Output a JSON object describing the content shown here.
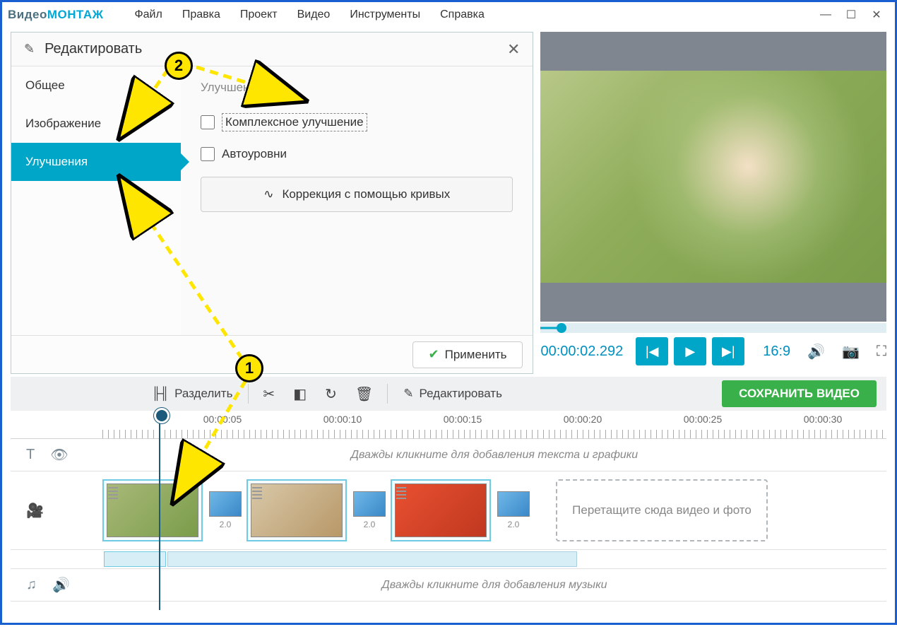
{
  "app": {
    "logo_a": "Видео",
    "logo_b": "МОНТАЖ"
  },
  "menu": [
    "Файл",
    "Правка",
    "Проект",
    "Видео",
    "Инструменты",
    "Справка"
  ],
  "edit_panel": {
    "title": "Редактировать",
    "tabs": [
      "Общее",
      "Изображение",
      "Улучшения"
    ],
    "active_tab": 2,
    "section": "Улучшения",
    "chk_complex": "Комплексное улучшение",
    "chk_auto": "Автоуровни",
    "curves_btn": "Коррекция с помощью кривых",
    "apply": "Применить"
  },
  "preview": {
    "timecode": "00:00:02.292",
    "ratio": "16:9"
  },
  "toolbar": {
    "split": "Разделить",
    "edit": "Редактировать",
    "save": "СОХРАНИТЬ ВИДЕО"
  },
  "ruler": [
    "00:00:05",
    "00:00:10",
    "00:00:15",
    "00:00:20",
    "00:00:25",
    "00:00:30"
  ],
  "tracks": {
    "text_placeholder": "Дважды кликните для добавления текста и графики",
    "drop_placeholder": "Перетащите сюда видео и фото",
    "music_placeholder": "Дважды кликните для добавления музыки",
    "transition_dur": "2.0"
  },
  "annotations": {
    "n1": "1",
    "n2": "2"
  }
}
